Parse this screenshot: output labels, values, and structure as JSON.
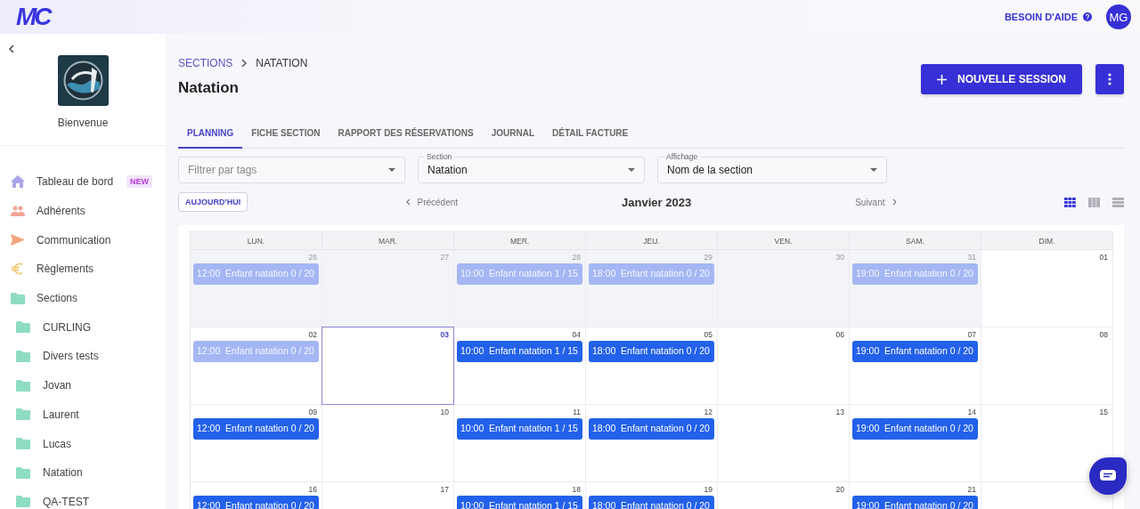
{
  "topbar": {
    "logo": "MC",
    "help": "BESOIN D'AIDE",
    "avatar": "MG"
  },
  "sidebar": {
    "welcome": "Bienvenue",
    "items": [
      {
        "label": "Tableau de bord",
        "badge": "NEW",
        "color": "#a9a6e8"
      },
      {
        "label": "Adhérents",
        "color": "#f2a496"
      },
      {
        "label": "Communication",
        "color": "#f5a27a"
      },
      {
        "label": "Règlements",
        "color": "#f3cc79"
      },
      {
        "label": "Sections",
        "color": "#8fdcc4",
        "children": [
          {
            "label": "CURLING"
          },
          {
            "label": "Divers tests"
          },
          {
            "label": "Jovan"
          },
          {
            "label": "Laurent"
          },
          {
            "label": "Lucas"
          },
          {
            "label": "Natation"
          },
          {
            "label": "QA-TEST"
          }
        ]
      }
    ]
  },
  "breadcrumb": {
    "parent": "SECTIONS",
    "current": "NATATION"
  },
  "title": "Natation",
  "actions": {
    "primary": "NOUVELLE SESSION"
  },
  "tabs": [
    {
      "label": "PLANNING",
      "selected": true
    },
    {
      "label": "FICHE SECTION",
      "selected": false
    },
    {
      "label": "RAPPORT DES RÉSERVATIONS",
      "selected": false
    },
    {
      "label": "JOURNAL",
      "selected": false
    },
    {
      "label": "DÉTAIL FACTURE",
      "selected": false
    }
  ],
  "filters": [
    {
      "placeholder": "Filtrer par tags"
    },
    {
      "label": "Section",
      "value": "Natation"
    },
    {
      "label": "Affichage",
      "value": "Nom de la section"
    }
  ],
  "toolbar": {
    "today": "AUJOURD'HUI",
    "previous": "Précédent",
    "month": "Janvier 2023",
    "next": "Suivant",
    "views": [
      {
        "selected": true
      },
      {
        "selected": false
      },
      {
        "selected": false
      }
    ]
  },
  "calendar": {
    "weekdays": [
      "LUN.",
      "MAR.",
      "MER.",
      "JEU.",
      "VEN.",
      "SAM.",
      "DIM."
    ],
    "weeks": [
      [
        {
          "day": "26",
          "outside": true,
          "today": false,
          "events": [
            {
              "text": "12:00  Enfant natation 0 / 20",
              "past": true
            }
          ]
        },
        {
          "day": "27",
          "outside": true,
          "today": false
        },
        {
          "day": "28",
          "outside": true,
          "today": false,
          "events": [
            {
              "text": "10:00  Enfant natation 1 / 15",
              "past": true
            }
          ]
        },
        {
          "day": "29",
          "outside": true,
          "today": false,
          "events": [
            {
              "text": "18:00  Enfant natation 0 / 20",
              "past": true
            }
          ]
        },
        {
          "day": "30",
          "outside": true,
          "today": false
        },
        {
          "day": "31",
          "outside": true,
          "today": false,
          "events": [
            {
              "text": "19:00  Enfant natation 0 / 20",
              "past": true
            }
          ]
        },
        {
          "day": "01",
          "outside": false,
          "today": false
        }
      ],
      [
        {
          "day": "02",
          "outside": false,
          "today": false,
          "events": [
            {
              "text": "12:00  Enfant natation 0 / 20",
              "past": true
            }
          ]
        },
        {
          "day": "03",
          "outside": false,
          "today": true
        },
        {
          "day": "04",
          "outside": false,
          "today": false,
          "events": [
            {
              "text": "10:00  Enfant natation 1 / 15",
              "past": false
            }
          ]
        },
        {
          "day": "05",
          "outside": false,
          "today": false,
          "events": [
            {
              "text": "18:00  Enfant natation 0 / 20",
              "past": false
            }
          ]
        },
        {
          "day": "06",
          "outside": false,
          "today": false
        },
        {
          "day": "07",
          "outside": false,
          "today": false,
          "events": [
            {
              "text": "19:00  Enfant natation 0 / 20",
              "past": false
            }
          ]
        },
        {
          "day": "08",
          "outside": false,
          "today": false
        }
      ],
      [
        {
          "day": "09",
          "outside": false,
          "today": false,
          "events": [
            {
              "text": "12:00  Enfant natation 0 / 20",
              "past": false
            }
          ]
        },
        {
          "day": "10",
          "outside": false,
          "today": false
        },
        {
          "day": "11",
          "outside": false,
          "today": false,
          "events": [
            {
              "text": "10:00  Enfant natation 1 / 15",
              "past": false
            }
          ]
        },
        {
          "day": "12",
          "outside": false,
          "today": false,
          "events": [
            {
              "text": "18:00  Enfant natation 0 / 20",
              "past": false
            }
          ]
        },
        {
          "day": "13",
          "outside": false,
          "today": false
        },
        {
          "day": "14",
          "outside": false,
          "today": false,
          "events": [
            {
              "text": "19:00  Enfant natation 0 / 20",
              "past": false
            }
          ]
        },
        {
          "day": "15",
          "outside": false,
          "today": false
        }
      ],
      [
        {
          "day": "16",
          "outside": false,
          "today": false,
          "events": [
            {
              "text": "12:00  Enfant natation 0 / 20",
              "past": false
            }
          ]
        },
        {
          "day": "17",
          "outside": false,
          "today": false
        },
        {
          "day": "18",
          "outside": false,
          "today": false,
          "events": [
            {
              "text": "10:00  Enfant natation 1 / 15",
              "past": false
            }
          ]
        },
        {
          "day": "19",
          "outside": false,
          "today": false,
          "events": [
            {
              "text": "18:00  Enfant natation 0 / 20",
              "past": false
            }
          ]
        },
        {
          "day": "20",
          "outside": false,
          "today": false
        },
        {
          "day": "21",
          "outside": false,
          "today": false,
          "events": [
            {
              "text": "19:00  Enfant natation 0 / 20",
              "past": false
            }
          ]
        }
      ]
    ]
  }
}
